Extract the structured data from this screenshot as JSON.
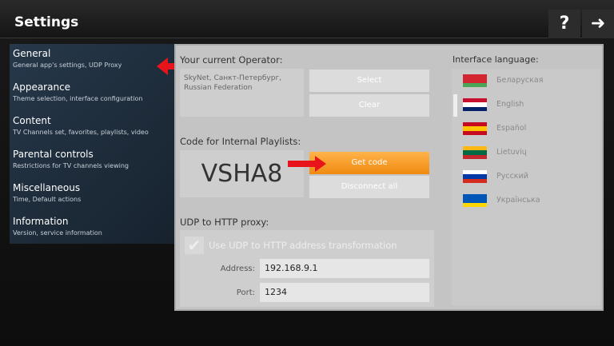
{
  "header": {
    "title": "Settings",
    "help_icon": "question-mark",
    "forward_icon": "arrow-right"
  },
  "sidebar": {
    "items": [
      {
        "title": "General",
        "subtitle": "General app's settings, UDP Proxy"
      },
      {
        "title": "Appearance",
        "subtitle": "Theme selection, interface configuration"
      },
      {
        "title": "Content",
        "subtitle": "TV Channels set, favorites, playlists, video"
      },
      {
        "title": "Parental controls",
        "subtitle": "Restrictions for TV channels viewing"
      },
      {
        "title": "Miscellaneous",
        "subtitle": "Time, Default actions"
      },
      {
        "title": "Information",
        "subtitle": "Version, service information"
      }
    ]
  },
  "operator": {
    "label": "Your current Operator:",
    "value": "SkyNet, Санкт-Петербург, Russian Federation",
    "select_label": "Select",
    "clear_label": "Clear"
  },
  "playlist": {
    "label": "Code for Internal Playlists:",
    "code": "VSHA8",
    "get_code_label": "Get code",
    "disconnect_label": "Disconnect all",
    "accent": "#f39a1e"
  },
  "proxy": {
    "label": "UDP to HTTP proxy:",
    "checkbox_label": "Use UDP to HTTP address transformation",
    "checked": true,
    "address_label": "Address:",
    "address": "192.168.9.1",
    "port_label": "Port:",
    "port": "1234"
  },
  "language": {
    "label": "Interface language:",
    "selected": "English",
    "items": [
      {
        "name": "Беларуская",
        "colors": [
          "#d22730",
          "#d22730",
          "#4aa657"
        ]
      },
      {
        "name": "English",
        "colors": [
          "#c8102e",
          "#ffffff",
          "#012169"
        ]
      },
      {
        "name": "Español",
        "colors": [
          "#c60b1e",
          "#ffc400",
          "#c60b1e"
        ]
      },
      {
        "name": "Lietuvių",
        "colors": [
          "#fdb913",
          "#006a44",
          "#c1272d"
        ]
      },
      {
        "name": "Русский",
        "colors": [
          "#ffffff",
          "#0039a6",
          "#d52b1e"
        ]
      },
      {
        "name": "Українська",
        "colors": [
          "#0057b7",
          "#0057b7",
          "#ffd700"
        ]
      }
    ]
  }
}
